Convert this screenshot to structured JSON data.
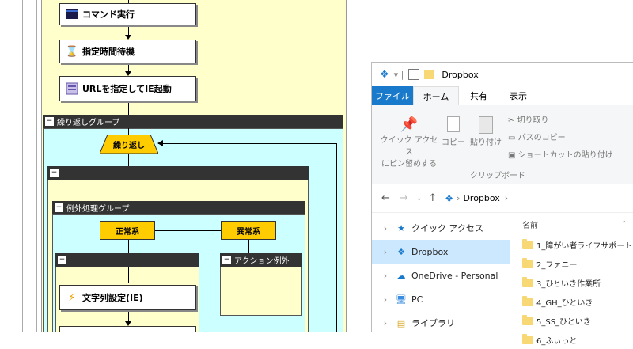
{
  "flow": {
    "nodes": [
      {
        "label": "コマンド実行",
        "icon": "terminal-icon"
      },
      {
        "label": "指定時間待機",
        "icon": "hourglass-icon"
      },
      {
        "label": "URLを指定してIE起動",
        "icon": "ie-icon"
      }
    ],
    "loop_group": {
      "title": "繰り返しグループ",
      "loop_label": "繰り返し"
    },
    "inner_group": {
      "title": ""
    },
    "exception_group": {
      "title": "例外処理グループ",
      "normal_label": "正常系",
      "abnormal_label": "異常系"
    },
    "normal_branch": {
      "title": ""
    },
    "action_exception": {
      "title": "アクション例外"
    },
    "string_node": {
      "label": "文字列設定(IE)",
      "icon": "lightning-icon"
    },
    "colors": {
      "lane": "#ffffcc",
      "group_body": "#ccffff",
      "header": "#333333",
      "orange": "#ffcc00"
    }
  },
  "explorer": {
    "title": "Dropbox",
    "quick_sep": "▾ |",
    "tabs": [
      "ファイル",
      "ホーム",
      "共有",
      "表示"
    ],
    "ribbon": {
      "pin_label_1": "クイック アクセス",
      "pin_label_2": "にピン留めする",
      "copy": "コピー",
      "paste": "貼り付け",
      "cut": "切り取り",
      "copy_path": "パスのコピー",
      "paste_shortcut": "ショートカットの貼り付け",
      "group_label": "クリップボード"
    },
    "address": {
      "path": "Dropbox",
      "sep": "›"
    },
    "nav": [
      {
        "label": "クイック アクセス",
        "icon": "star-icon"
      },
      {
        "label": "Dropbox",
        "icon": "dropbox-icon"
      },
      {
        "label": "OneDrive - Personal",
        "icon": "cloud-icon"
      },
      {
        "label": "PC",
        "icon": "pc-icon"
      },
      {
        "label": "ライブラリ",
        "icon": "library-icon"
      }
    ],
    "list_header": "名前",
    "files": [
      "1_障がい者ライフサポート",
      "2_ファニー",
      "3_ひといき作業所",
      "4_GH_ひといき",
      "5_SS_ひといき",
      "6_ふぃっと"
    ],
    "colors": {
      "accent": "#1979ca",
      "folder": "#f8d775",
      "selected": "#cce8ff"
    }
  }
}
